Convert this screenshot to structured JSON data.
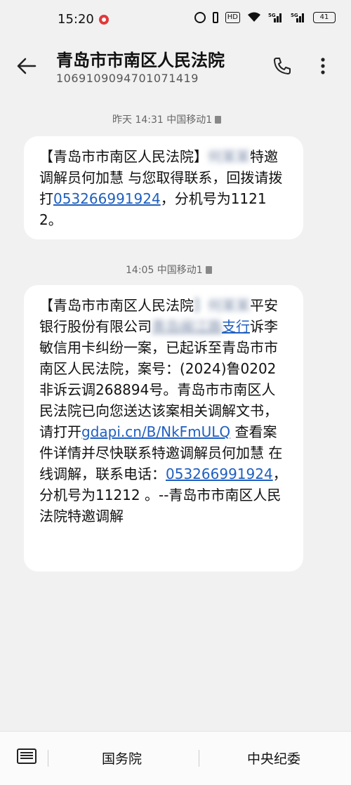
{
  "status_bar": {
    "time": "15:20",
    "battery": "41",
    "hd": "HD",
    "signal1": "5G",
    "signal2": "5G"
  },
  "header": {
    "title": "青岛市市南区人民法院",
    "number": "106910909470107141​9"
  },
  "messages": [
    {
      "meta": "昨天 14:31 中国移动1",
      "text_a": "【青岛市市南区人民法院】",
      "redacted": "何某某",
      "text_b": "特邀调解员何加慧 与您取得联系，回拨请拨打",
      "link": "053266991924",
      "text_c": "，分机号为11212。"
    },
    {
      "meta": "14:05 中国移动1",
      "text_a": "【青岛市市南区人民法院",
      "redacted": "】何某某",
      "text_b": "平安银行股份有限公司",
      "link_blur": "青岛闽江路",
      "link_2": "支行",
      "text_c": "诉李敏信用卡纠纷一案，已起诉至青岛市市南区人民法院，案号：(2024)鲁0202非诉云调268894号。青岛市市南区人民法院已向您送达该案相关调解文书，请打开",
      "link_url": "gdapi.cn/B/NkFmULQ",
      "text_d": " 查看案件详情并尽快联系特邀调解员何加慧 在线调解，联系电话：",
      "link_phone": "053266991924",
      "text_e": "，分机号为11212 。--青岛市市南区人民法院特邀调解"
    }
  ],
  "bottom_bar": {
    "quick_reply_1": "国务院",
    "quick_reply_2": "中央纪委"
  }
}
